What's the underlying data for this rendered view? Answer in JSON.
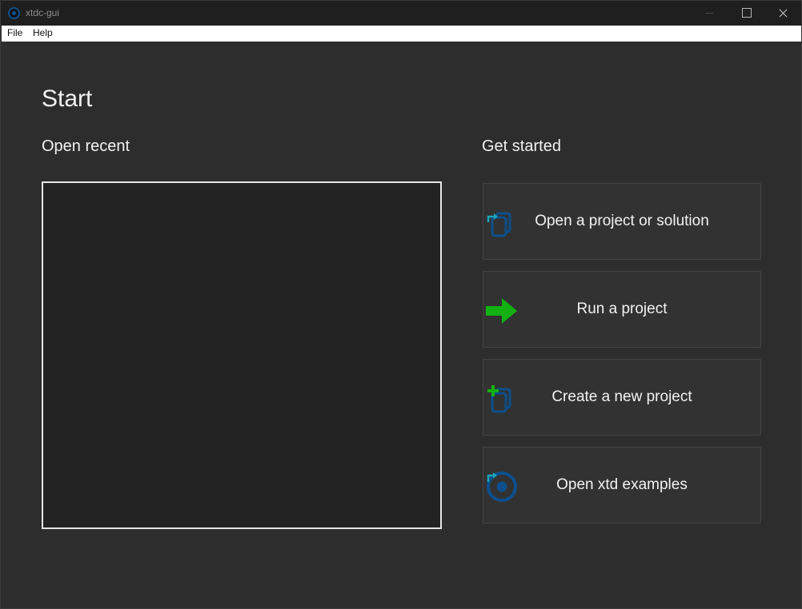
{
  "window": {
    "title": "xtdc-gui"
  },
  "menu": {
    "file": "File",
    "help": "Help"
  },
  "page": {
    "heading": "Start",
    "open_recent": "Open recent",
    "get_started": "Get started"
  },
  "actions": [
    {
      "label": "Open a project or solution",
      "icon": "open-project-icon"
    },
    {
      "label": "Run a project",
      "icon": "run-arrow-icon"
    },
    {
      "label": "Create a new project",
      "icon": "new-project-icon"
    },
    {
      "label": "Open xtd examples",
      "icon": "xtd-examples-icon"
    }
  ],
  "colors": {
    "background": "#2d2d2d",
    "titlebar": "#1f1f1f",
    "recent_bg": "#222222",
    "accent_blue": "#0c4f8c",
    "accent_teal": "#1aa6b7",
    "accent_green": "#12b010"
  }
}
